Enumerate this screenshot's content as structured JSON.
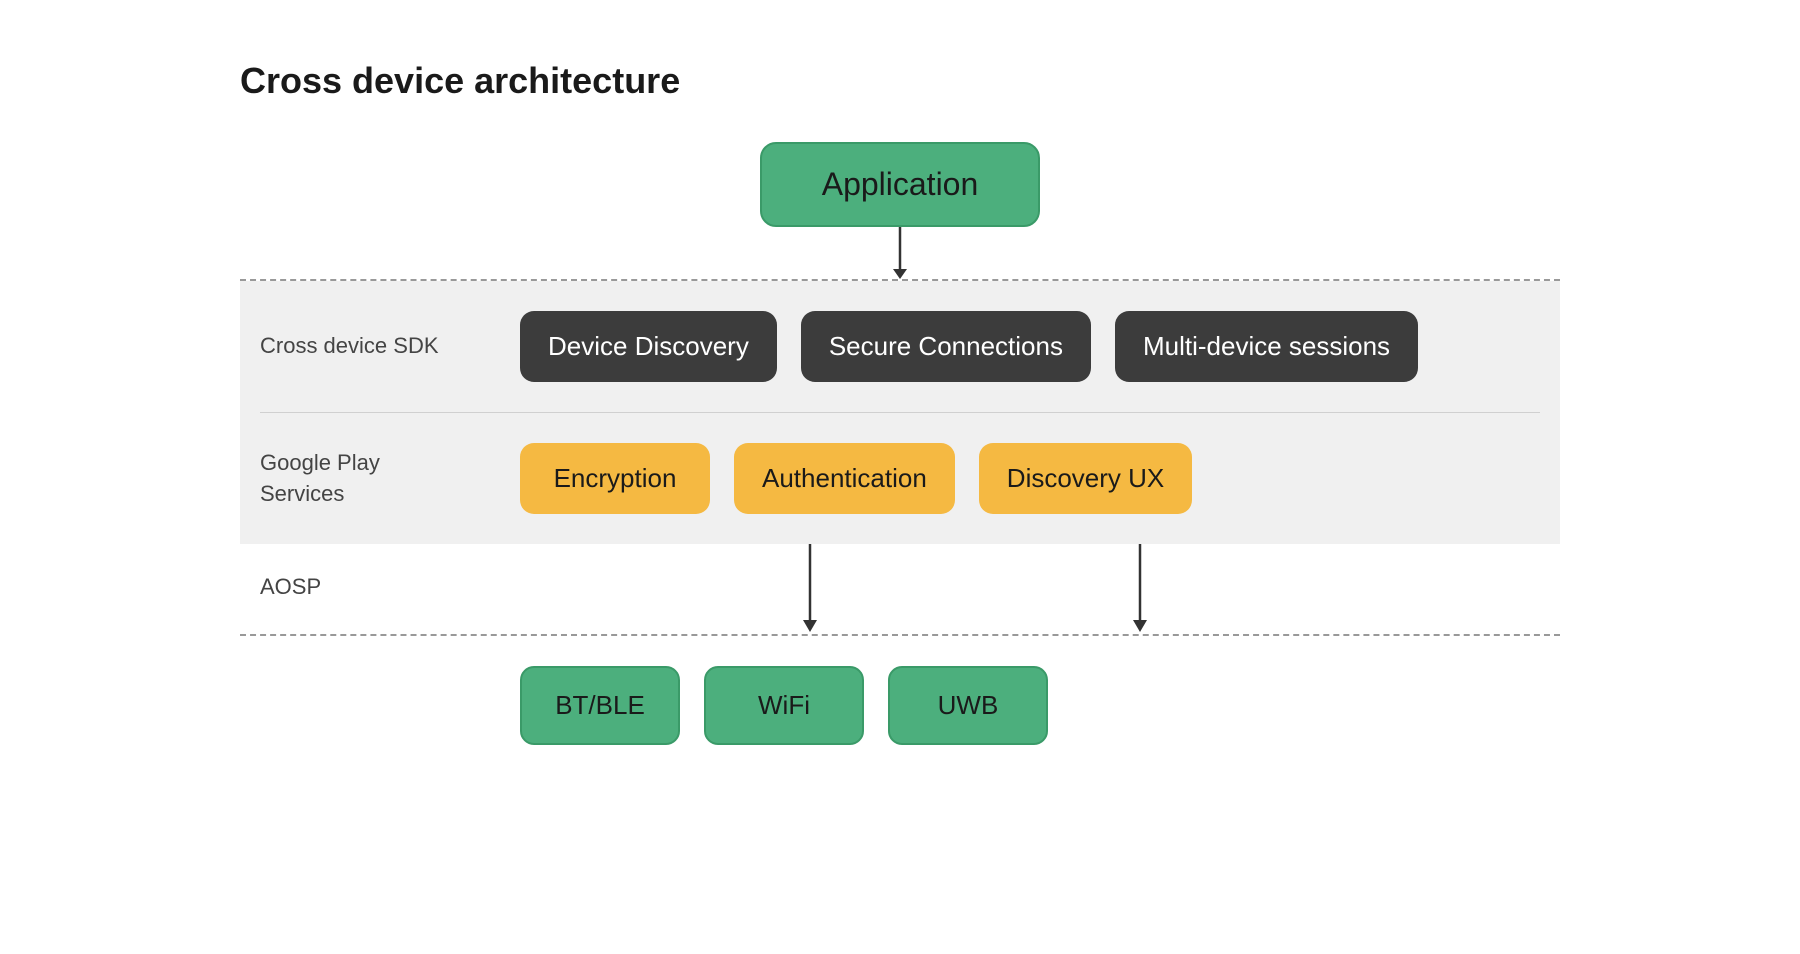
{
  "title": "Cross device architecture",
  "app_box": "Application",
  "sdk_label": "Cross device SDK",
  "sdk_boxes": [
    {
      "id": "device-discovery",
      "text": "Device Discovery"
    },
    {
      "id": "secure-connections",
      "text": "Secure Connections"
    },
    {
      "id": "multi-device-sessions",
      "text": "Multi-device sessions"
    }
  ],
  "gps_label": "Google Play Services",
  "gps_boxes": [
    {
      "id": "encryption",
      "text": "Encryption"
    },
    {
      "id": "authentication",
      "text": "Authentication"
    },
    {
      "id": "discovery-ux",
      "text": "Discovery UX"
    }
  ],
  "aosp_label": "AOSP",
  "bottom_boxes": [
    {
      "id": "bt-ble",
      "text": "BT/BLE"
    },
    {
      "id": "wifi",
      "text": "WiFi"
    },
    {
      "id": "uwb",
      "text": "UWB"
    }
  ]
}
